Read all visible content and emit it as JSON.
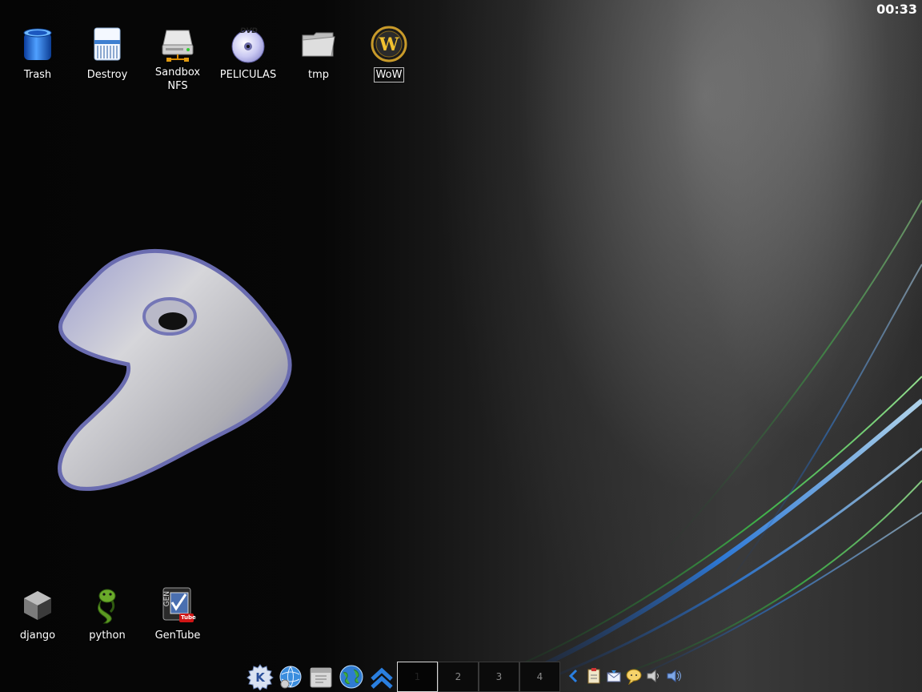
{
  "clock": "00:33",
  "desktop_icons_top": [
    {
      "name": "trash-icon",
      "label": "Trash"
    },
    {
      "name": "destroy-icon",
      "label": "Destroy"
    },
    {
      "name": "sandbox-nfs-icon",
      "label": "Sandbox NFS"
    },
    {
      "name": "peliculas-icon",
      "label": "PELICULAS"
    },
    {
      "name": "tmp-icon",
      "label": "tmp"
    },
    {
      "name": "wow-icon",
      "label": "WoW"
    }
  ],
  "desktop_icons_bottom": [
    {
      "name": "django-icon",
      "label": "django"
    },
    {
      "name": "python-icon",
      "label": "python"
    },
    {
      "name": "gentube-icon",
      "label": "GenTube"
    }
  ],
  "dvd_badge": "DVD",
  "gentube_badge": "GEN",
  "youtube_badge": "Tube",
  "pager": {
    "desktops": [
      "1",
      "2",
      "3",
      "4"
    ],
    "active": "1"
  },
  "colors": {
    "accent_blue": "#3a8dde",
    "gentoo_purple": "#7d7fc4"
  }
}
